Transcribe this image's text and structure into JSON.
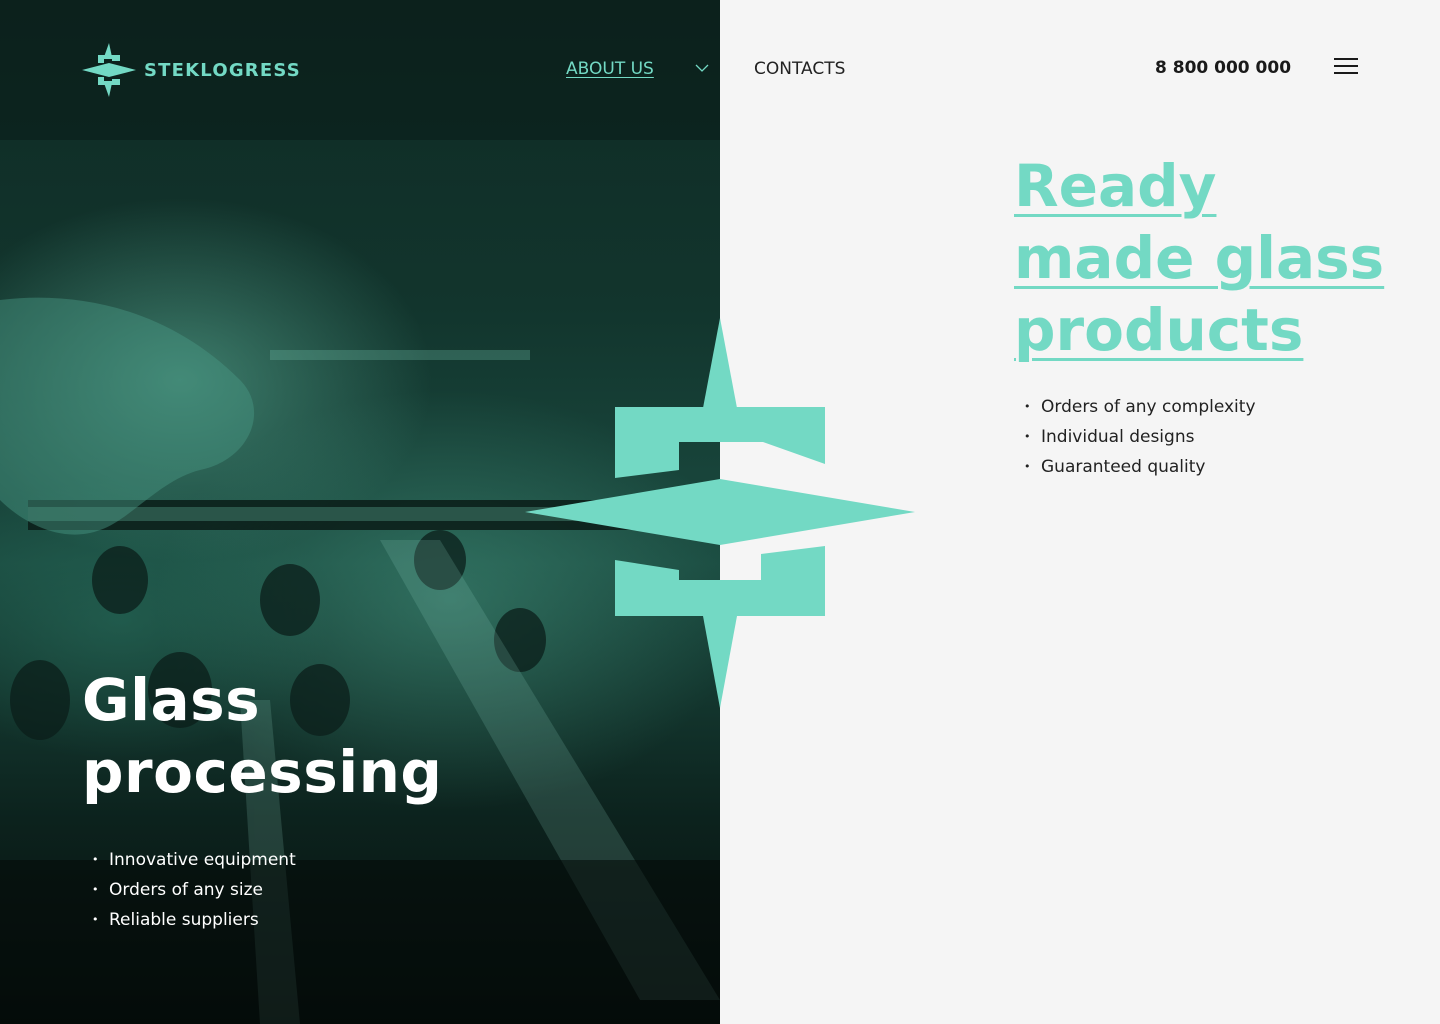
{
  "brand": {
    "name": "STEKLOGRESS",
    "accent_color": "#73d9c4",
    "logo_icon": "steklogress-star-icon"
  },
  "nav": {
    "about_label": "ABOUT US",
    "about_chevron_icon": "chevron-down-icon",
    "contacts_label": "CONTACTS",
    "phone": "8 800 000 000",
    "menu_icon": "hamburger-menu-icon"
  },
  "left": {
    "title_line1": "Glass",
    "title_line2": "processing",
    "items": [
      "Innovative equipment",
      "Orders of any size",
      "Reliable suppliers"
    ]
  },
  "right": {
    "title_line1": "Ready",
    "title_line2": "made glass",
    "title_line3": "products",
    "items": [
      "Orders of any complexity",
      "Individual designs",
      "Guaranteed quality"
    ]
  },
  "emblem_icon": "steklogress-emblem-icon",
  "colors": {
    "dark_bg": "#0c221d",
    "light_bg": "#f5f5f5",
    "text_dark": "#1a1a1a"
  }
}
